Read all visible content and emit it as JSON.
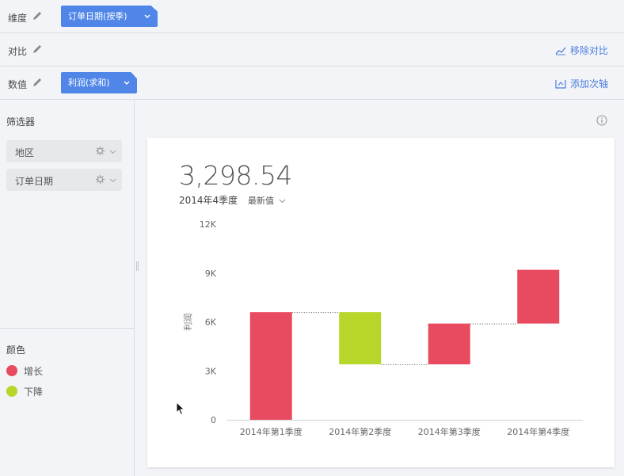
{
  "shelf": {
    "dimension": {
      "label": "维度",
      "chip": "订单日期(按季)"
    },
    "compare": {
      "label": "对比",
      "action": "移除对比"
    },
    "measure": {
      "label": "数值",
      "chip": "利润(求和)",
      "action": "添加次轴"
    }
  },
  "sidebar": {
    "filter_title": "筛选器",
    "filters": [
      {
        "label": "地区"
      },
      {
        "label": "订单日期"
      }
    ],
    "color_title": "颜色",
    "legend": [
      {
        "label": "增长",
        "color": "#e84b5f"
      },
      {
        "label": "下降",
        "color": "#b6d62a"
      }
    ]
  },
  "kpi": {
    "value": "3,298.54",
    "period": "2014年4季度",
    "mode": "最新值"
  },
  "icons": [
    "pencil-icon",
    "chevron-down-icon",
    "remove-compare-icon",
    "secondary-axis-icon",
    "gear-icon",
    "info-icon",
    "cursor-icon"
  ],
  "chart_data": {
    "type": "bar",
    "subtype": "waterfall",
    "categories": [
      "2014年第1季度",
      "2014年第2季度",
      "2014年第3季度",
      "2014年第4季度"
    ],
    "series": [
      {
        "name": "利润",
        "start": [
          0,
          6600,
          3400,
          5900
        ],
        "end": [
          6600,
          3400,
          5900,
          9200
        ]
      }
    ],
    "ylabel": "利润",
    "ylim": [
      0,
      12000
    ],
    "yticks": [
      "0",
      "3K",
      "6K",
      "9K",
      "12K"
    ],
    "colors": {
      "increase": "#e84b5f",
      "decrease": "#b6d62a"
    },
    "connectors": "dotted"
  }
}
